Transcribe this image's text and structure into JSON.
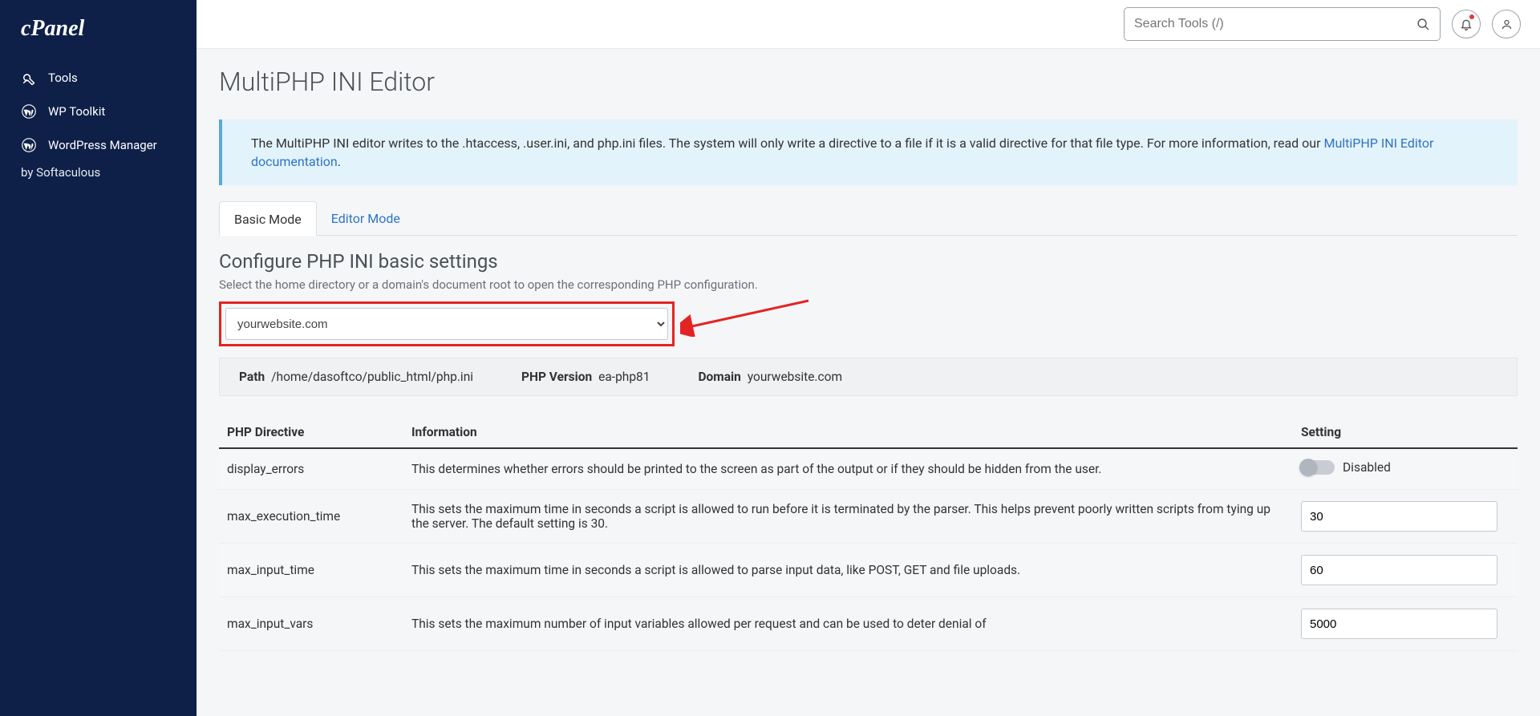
{
  "sidebar": {
    "brand": "cPanel",
    "items": [
      {
        "label": "Tools",
        "icon": "tools"
      },
      {
        "label": "WP Toolkit",
        "icon": "wp"
      },
      {
        "label": "WordPress Manager",
        "icon": "wp"
      }
    ],
    "subline": "by Softaculous"
  },
  "topbar": {
    "search_placeholder": "Search Tools (/)"
  },
  "page": {
    "title": "MultiPHP INI Editor",
    "info_text_1": "The MultiPHP INI editor writes to the .htaccess, .user.ini, and php.ini files. The system will only write a directive to a file if it is a valid directive for that file type. For more information, read our ",
    "info_link": "MultiPHP INI Editor documentation",
    "info_text_2": ".",
    "tabs": {
      "basic": "Basic Mode",
      "editor": "Editor Mode"
    },
    "section_title": "Configure PHP INI basic settings",
    "section_sub": "Select the home directory or a domain's document root to open the corresponding PHP configuration.",
    "domain_selected": "yourwebsite.com",
    "infobar": {
      "path_label": "Path",
      "path_value": "/home/dasoftco/public_html/php.ini",
      "phpver_label": "PHP Version",
      "phpver_value": "ea-php81",
      "domain_label": "Domain",
      "domain_value": "yourwebsite.com"
    },
    "table": {
      "headers": {
        "dir": "PHP Directive",
        "info": "Information",
        "set": "Setting"
      },
      "rows": [
        {
          "dir": "display_errors",
          "info": "This determines whether errors should be printed to the screen as part of the output or if they should be hidden from the user.",
          "type": "toggle",
          "value": "Disabled"
        },
        {
          "dir": "max_execution_time",
          "info": "This sets the maximum time in seconds a script is allowed to run before it is terminated by the parser. This helps prevent poorly written scripts from tying up the server. The default setting is 30.",
          "type": "input",
          "value": "30"
        },
        {
          "dir": "max_input_time",
          "info": "This sets the maximum time in seconds a script is allowed to parse input data, like POST, GET and file uploads.",
          "type": "input",
          "value": "60"
        },
        {
          "dir": "max_input_vars",
          "info": "This sets the maximum number of input variables allowed per request and can be used to deter denial of",
          "type": "input",
          "value": "5000"
        }
      ]
    }
  }
}
